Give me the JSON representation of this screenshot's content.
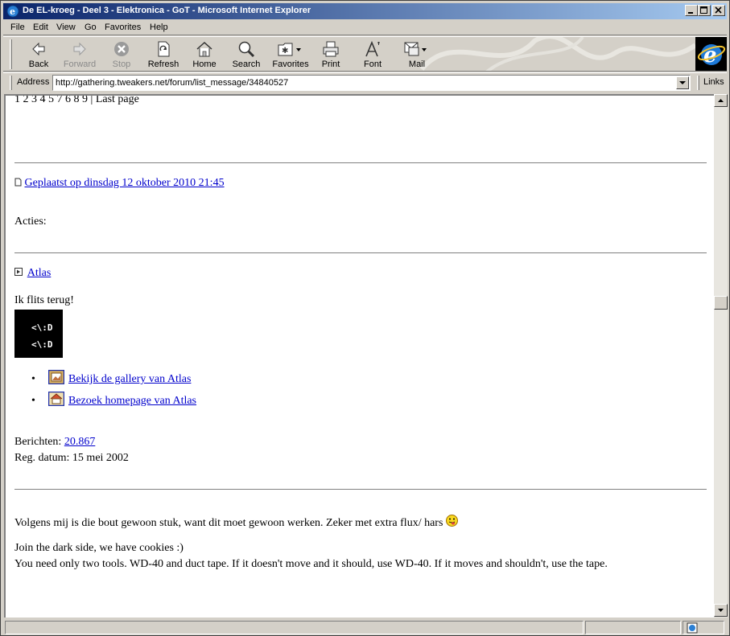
{
  "window": {
    "title": "De EL-kroeg - Deel 3 - Elektronica - GoT - Microsoft Internet Explorer"
  },
  "menu": [
    "File",
    "Edit",
    "View",
    "Go",
    "Favorites",
    "Help"
  ],
  "toolbar": {
    "back": "Back",
    "forward": "Forward",
    "stop": "Stop",
    "refresh": "Refresh",
    "home": "Home",
    "search": "Search",
    "favorites": "Favorites",
    "print": "Print",
    "font": "Font",
    "mail": "Mail"
  },
  "address": {
    "label": "Address",
    "url": "http://gathering.tweakers.net/forum/list_message/34840527",
    "links": "Links"
  },
  "page": {
    "pagination_numbers": "1 2 3 4 5 7 6 8 9 |",
    "last_page": "Last page",
    "posted": "Geplaatst op dinsdag 12 oktober 2010 21:45",
    "actions": "Acties:",
    "author": "Atlas",
    "user_title": "Ik flits terug!",
    "avatar_line1": "<\\:D",
    "avatar_line2": "<\\:D",
    "gallery_link": "Bekijk de gallery van Atlas",
    "homepage_link": "Bezoek homepage van Atlas",
    "posts_label": "Berichten:",
    "posts_count": "20.867",
    "reg_date": "Reg. datum: 15 mei 2002",
    "message": "Volgens mij is die bout gewoon stuk, want dit moet gewoon werken. Zeker met extra flux/ hars",
    "sig_line1": "Join the dark side, we have cookies :)",
    "sig_line2": "You need only two tools. WD-40 and duct tape. If it doesn't move and it should, use WD-40. If it moves and shouldn't, use the tape."
  },
  "colors": {
    "titlebar_start": "#0a246a",
    "titlebar_end": "#a6caf0",
    "link": "#0000cc",
    "chrome": "#d4d0c8"
  }
}
